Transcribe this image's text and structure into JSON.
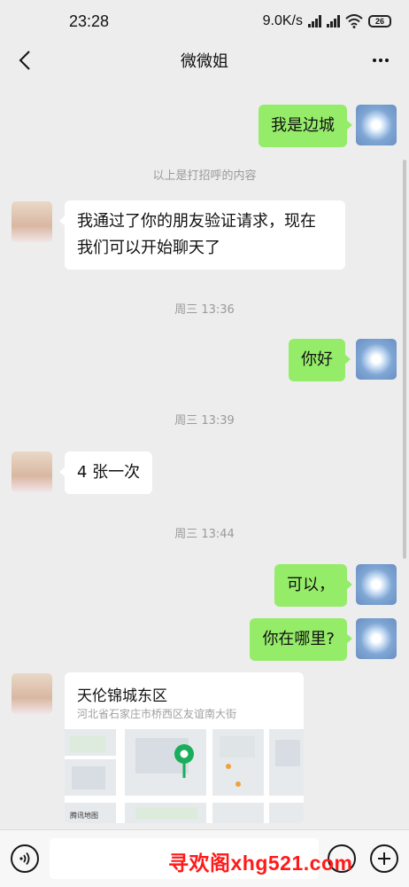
{
  "status_bar": {
    "time": "23:28",
    "network_speed": "9.0K/s",
    "battery": "26"
  },
  "header": {
    "title": "微微姐"
  },
  "messages": {
    "m1": "我是边城",
    "greeting_note": "以上是打招呼的内容",
    "m2_line1": "我通过了你的朋友验证请求，现在",
    "m2_line2": "我们可以开始聊天了",
    "ts1": "周三 13:36",
    "m3": "你好",
    "ts2": "周三 13:39",
    "m4": "4 张一次",
    "ts3": "周三 13:44",
    "m5": "可以，",
    "m6": "你在哪里?"
  },
  "location": {
    "name": "天伦锦城东区",
    "address": "河北省石家庄市桥西区友谊南大街",
    "map_source": "腾讯地图",
    "pin_color": "#1aad5b"
  },
  "watermark": "寻欢阁xhg521.com",
  "colors": {
    "my_bubble": "#95ec69",
    "their_bubble": "#ffffff",
    "background": "#ededed"
  }
}
